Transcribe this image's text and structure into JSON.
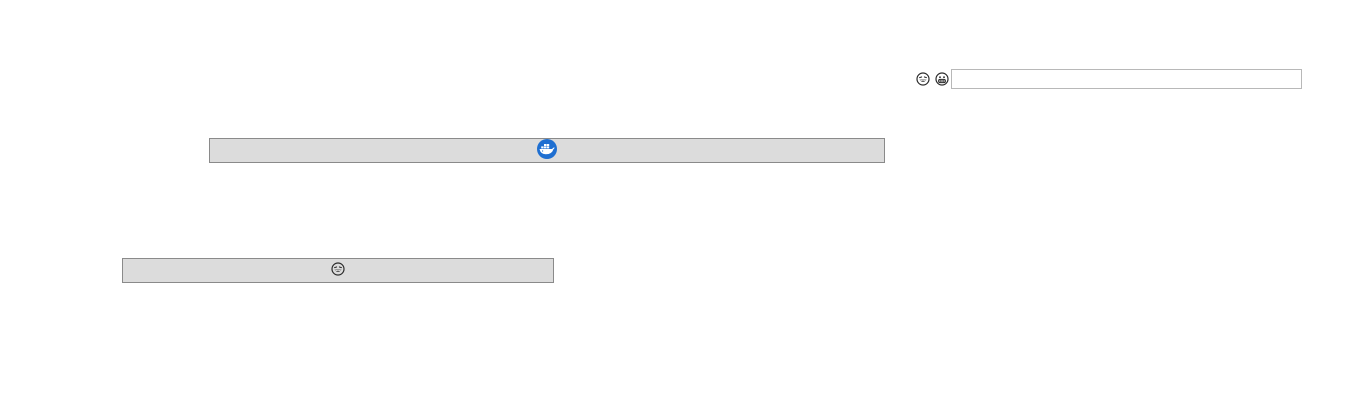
{
  "toolbar": {
    "icons": [
      {
        "name": "laughing-face-icon",
        "stroke": "#2b2b2b"
      },
      {
        "name": "grinning-face-icon",
        "stroke": "#2b2b2b"
      }
    ],
    "input": {
      "value": "",
      "placeholder": ""
    }
  },
  "buttons": [
    {
      "icon": "docker-whale-icon",
      "color": "#1f6fd1"
    },
    {
      "icon": "laughing-face-icon",
      "color": "#2b2b2b"
    }
  ],
  "colors": {
    "button_fill": "#dcdcdc",
    "button_border": "#8a8a8a",
    "input_border": "#b8b8b8",
    "accent_blue": "#1f6fd1"
  }
}
